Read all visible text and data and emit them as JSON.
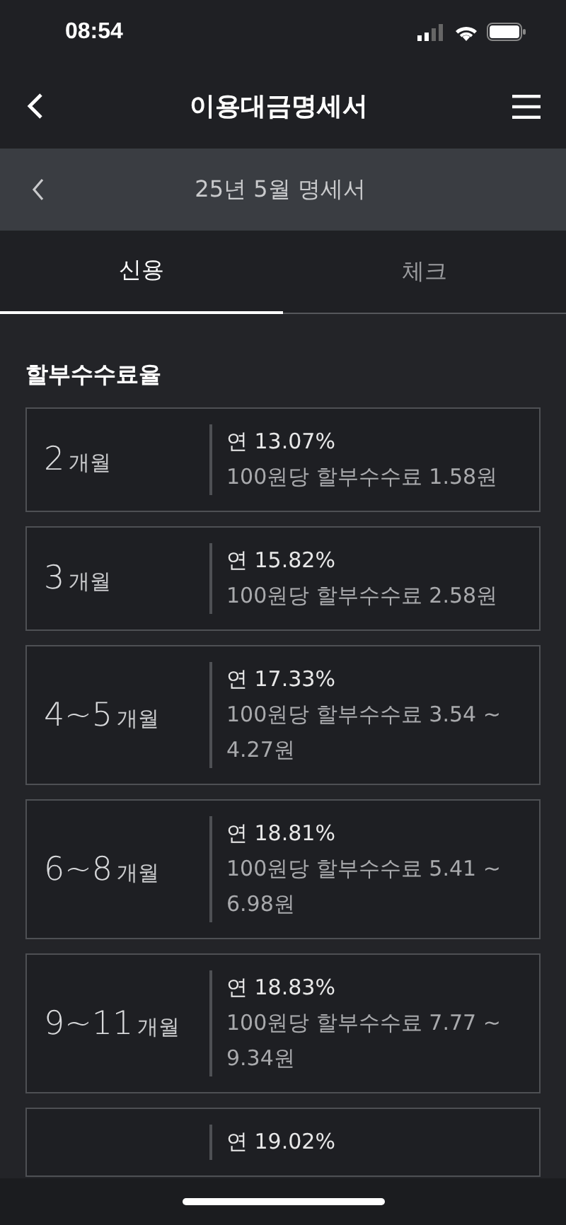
{
  "status_bar": {
    "time": "08:54"
  },
  "header": {
    "title": "이용대금명세서"
  },
  "statement_bar": {
    "title": "25년 5월 명세서"
  },
  "tabs": [
    {
      "label": "신용",
      "selected": true
    },
    {
      "label": "체크",
      "selected": false
    }
  ],
  "section": {
    "title": "할부수수료율"
  },
  "rates": [
    {
      "months_number": "2",
      "months_unit": "개월",
      "annual_rate": "연 13.07%",
      "fee": "100원당 할부수수료 1.58원"
    },
    {
      "months_number": "3",
      "months_unit": "개월",
      "annual_rate": "연 15.82%",
      "fee": "100원당 할부수수료 2.58원"
    },
    {
      "months_number": "4~5",
      "months_unit": "개월",
      "annual_rate": "연 17.33%",
      "fee": "100원당 할부수수료 3.54 ~ 4.27원"
    },
    {
      "months_number": "6~8",
      "months_unit": "개월",
      "annual_rate": "연 18.81%",
      "fee": "100원당 할부수수료 5.41 ~ 6.98원"
    },
    {
      "months_number": "9~11",
      "months_unit": "개월",
      "annual_rate": "연 18.83%",
      "fee": "100원당 할부수수료 7.77 ~ 9.34원"
    },
    {
      "annual_rate": "연 19.02%"
    }
  ]
}
